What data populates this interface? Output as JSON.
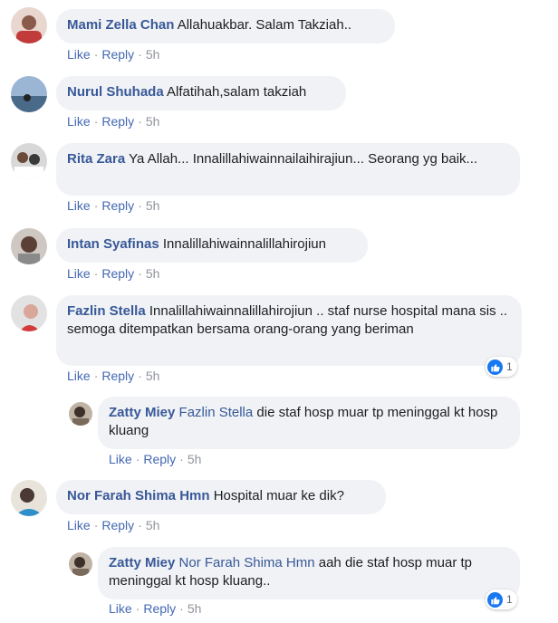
{
  "labels": {
    "like": "Like",
    "reply": "Reply",
    "dot": "·"
  },
  "comments": [
    {
      "author": "Mami Zella Chan",
      "text": "Allahuakbar. Salam Takziah..",
      "time": "5h"
    },
    {
      "author": "Nurul Shuhada",
      "text": "Alfatihah,salam takziah",
      "time": "5h"
    },
    {
      "author": "Rita Zara",
      "text": "Ya Allah... Innalillahiwainnailaihirajiun... Seorang yg baik...",
      "time": "5h"
    },
    {
      "author": "Intan Syafinas",
      "text": "Innalillahiwainnalillahirojiun",
      "time": "5h"
    },
    {
      "author": "Fazlin Stella",
      "text": "Innalillahiwainnalillahirojiun .. staf nurse hospital mana sis .. semoga ditempatkan bersama orang-orang yang beriman",
      "time": "5h",
      "reaction_count": "1"
    },
    {
      "author": "Zatty Miey",
      "mention": "Fazlin Stella",
      "text": "die staf hosp muar tp meninggal kt hosp kluang",
      "time": "5h"
    },
    {
      "author": "Nor Farah Shima Hmn",
      "text": "Hospital muar ke dik?",
      "time": "5h"
    },
    {
      "author": "Zatty Miey",
      "mention": "Nor Farah Shima Hmn",
      "text": "aah die staf hosp muar tp meninggal kt hosp kluang..",
      "time": "5h",
      "reaction_count": "1"
    }
  ],
  "colors": {
    "link": "#385898",
    "bubble": "#f0f2f5",
    "like_blue": "#1877f2"
  }
}
